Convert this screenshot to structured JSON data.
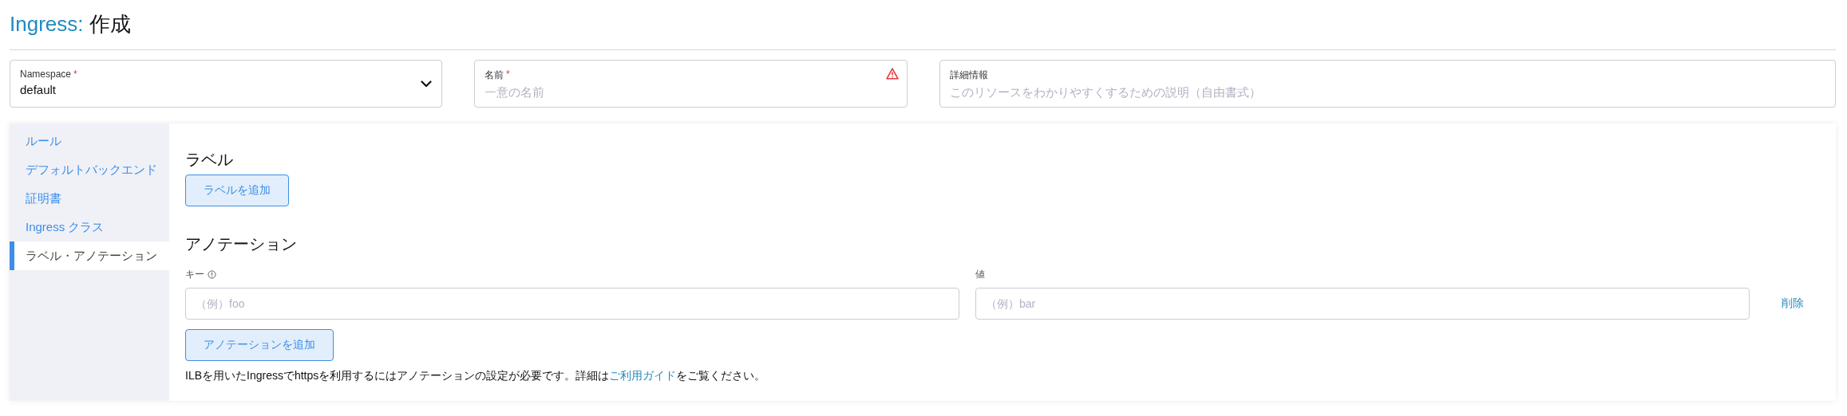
{
  "page_title": {
    "kind_label": "Ingress:",
    "action": "作成"
  },
  "fields": [
    {
      "kind": "select",
      "label": "Namespace",
      "required_mark": "*",
      "value": "default",
      "error": false
    },
    {
      "kind": "text",
      "label": "名前",
      "required_mark": "*",
      "placeholder": "一意の名前",
      "error": true
    },
    {
      "kind": "text",
      "label": "詳細情報",
      "placeholder": "このリソースをわかりやすくするための説明（自由書式）",
      "error": false
    }
  ],
  "sidebar": {
    "items": [
      {
        "label": "ルール",
        "selected": false
      },
      {
        "label": "デフォルトバックエンド",
        "selected": false
      },
      {
        "label": "証明書",
        "selected": false
      },
      {
        "label": "Ingress クラス",
        "selected": false
      },
      {
        "label": "ラベル・アノテーション",
        "selected": true
      }
    ]
  },
  "labels_section": {
    "heading": "ラベル",
    "add_button": "ラベルを追加"
  },
  "annotations_section": {
    "heading": "アノテーション",
    "key_label": "キー",
    "value_label": "値",
    "rows": [
      {
        "key_placeholder": "（例）foo",
        "value_placeholder": "（例）bar",
        "remove": "削除"
      }
    ],
    "add_button": "アノテーションを追加",
    "note": {
      "before": "ILBを用いたIngressでhttpsを利用するにはアノテーションの設定が必要です。詳細は",
      "link": "ご利用ガイド",
      "after": "をご覧ください。"
    }
  }
}
